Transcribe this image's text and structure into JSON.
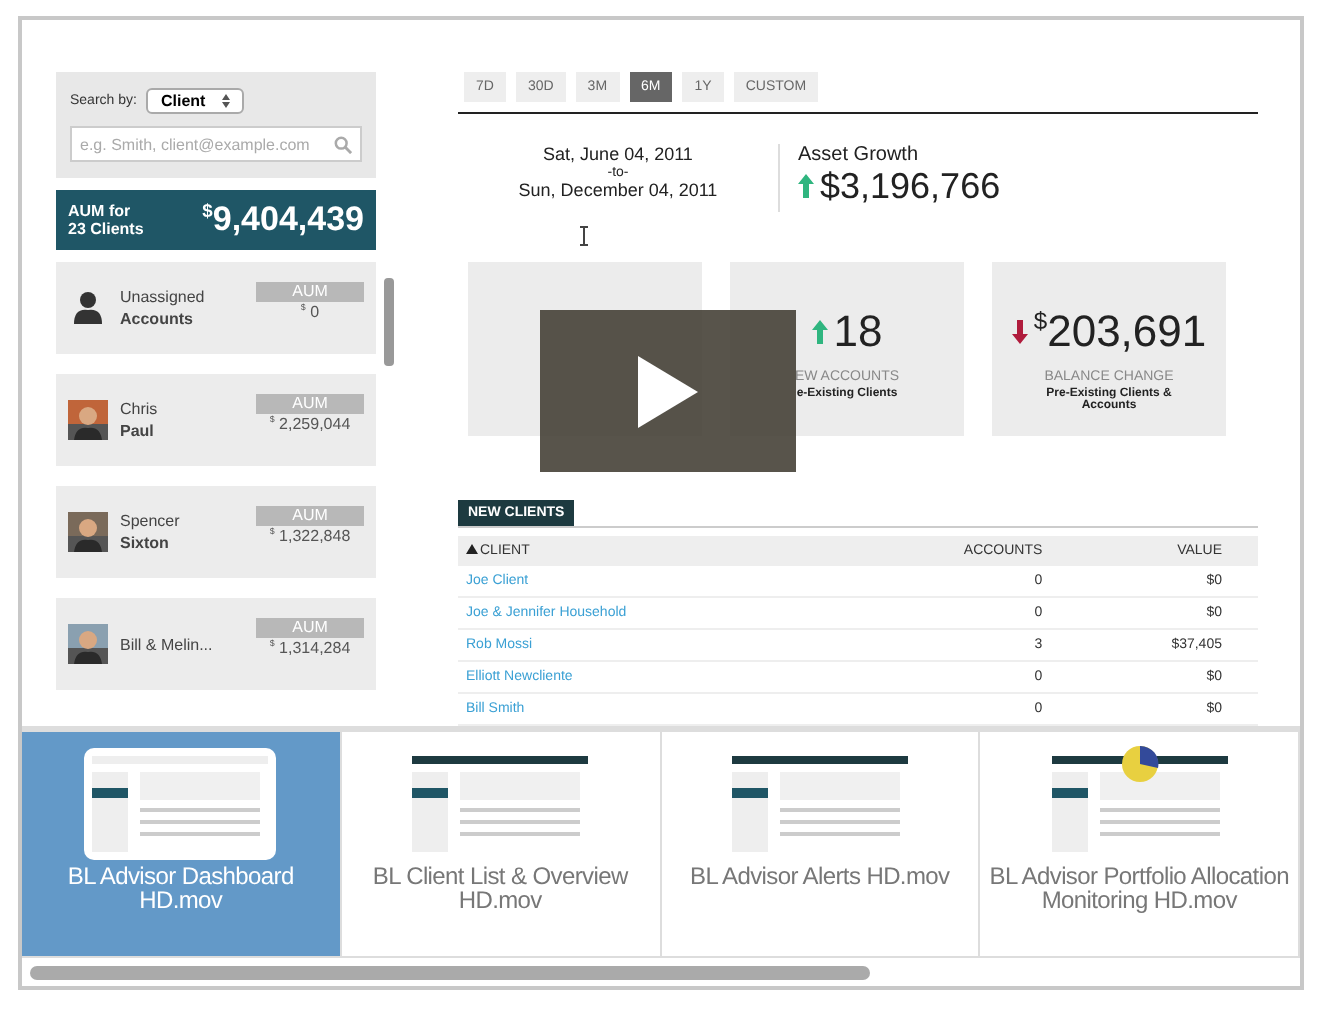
{
  "search": {
    "label": "Search by:",
    "select": "Client",
    "placeholder": "e.g. Smith, client@example.com"
  },
  "aum_summary": {
    "label_1": "AUM for",
    "label_2": "23 Clients",
    "currency": "$",
    "amount": "9,404,439"
  },
  "clients": [
    {
      "kind": "unassigned",
      "first": "Unassigned",
      "last": "Accounts",
      "aum_label": "AUM",
      "currency": "$",
      "amount": "0"
    },
    {
      "first": "Chris",
      "last": "Paul",
      "aum_label": "AUM",
      "currency": "$",
      "amount": "2,259,044"
    },
    {
      "first": "Spencer",
      "last": "Sixton",
      "aum_label": "AUM",
      "currency": "$",
      "amount": "1,322,848"
    },
    {
      "first": "Bill & Melin...",
      "aum_label": "AUM",
      "currency": "$",
      "amount": "1,314,284"
    }
  ],
  "range_tabs": [
    {
      "label": "7D",
      "selected": false
    },
    {
      "label": "30D",
      "selected": false
    },
    {
      "label": "3M",
      "selected": false
    },
    {
      "label": "6M",
      "selected": true
    },
    {
      "label": "1Y",
      "selected": false
    },
    {
      "label": "CUSTOM",
      "selected": false
    }
  ],
  "date_range": {
    "start": "Sat, June 04, 2011",
    "separator": "-to-",
    "end": "Sun, December 04, 2011"
  },
  "asset_growth": {
    "title": "Asset Growth",
    "rising": true,
    "amount": "$3,196,766"
  },
  "stats": [
    {
      "kind": "covered"
    },
    {
      "kind": "figure",
      "rising": true,
      "value": "18",
      "label": "EW ACCOUNTS",
      "note": "e-Existing Clients"
    },
    {
      "kind": "figure",
      "rising": false,
      "currency": "$",
      "value": "203,691",
      "label": "BALANCE CHANGE",
      "note": "Pre-Existing Clients & Accounts"
    }
  ],
  "new_clients": {
    "title": "NEW CLIENTS",
    "columns": [
      {
        "label": "CLIENT",
        "sorted_ascending": true
      },
      {
        "label": "ACCOUNTS",
        "sorted_ascending": false
      },
      {
        "label": "VALUE",
        "sorted_ascending": false
      }
    ],
    "rows": [
      {
        "client": "Joe Client",
        "accounts": "0",
        "value": "$0"
      },
      {
        "client": "Joe & Jennifer Household",
        "accounts": "0",
        "value": "$0"
      },
      {
        "client": "Rob Mossi",
        "accounts": "3",
        "value": "$37,405"
      },
      {
        "client": "Elliott Newcliente",
        "accounts": "0",
        "value": "$0"
      },
      {
        "client": "Bill Smith",
        "accounts": "0",
        "value": "$0"
      }
    ]
  },
  "playlist": [
    {
      "title": "BL Advisor Dashboard HD.mov",
      "selected": true
    },
    {
      "title": "BL Client List & Overview HD.mov",
      "selected": false
    },
    {
      "title": "BL Advisor Alerts HD.mov",
      "selected": false
    },
    {
      "title": "BL Advisor Portfolio Allocation Monitoring HD.mov",
      "selected": false
    }
  ]
}
